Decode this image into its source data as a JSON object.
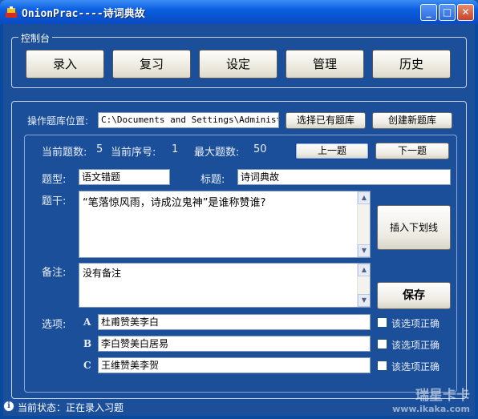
{
  "window": {
    "title": "OnionPrac----诗词典故",
    "minimize": "_",
    "maximize": "□",
    "close": "✕"
  },
  "console": {
    "legend": "控制台",
    "buttons": [
      "录入",
      "复习",
      "设定",
      "管理",
      "历史"
    ]
  },
  "db": {
    "label": "操作题库位置:",
    "path": "C:\\Documents and Settings\\Administrat",
    "select_btn": "选择已有题库",
    "create_btn": "创建新题库"
  },
  "counters": {
    "total_label": "当前题数:",
    "total_value": "5",
    "index_label": "当前序号:",
    "index_value": "1",
    "max_label": "最大题数:",
    "max_value": "50",
    "prev_btn": "上一题",
    "next_btn": "下一题"
  },
  "fields": {
    "type_label": "题型:",
    "type_value": "语文错题",
    "title_label": "标题:",
    "title_value": "诗词典故",
    "stem_label": "题干:",
    "stem_value": "“笔落惊风雨，诗成泣鬼神”是谁称赞谁?",
    "underline_btn": "插入下划线",
    "note_label": "备注:",
    "note_value": "没有备注",
    "save_btn": "保存"
  },
  "options": {
    "label": "选项:",
    "items": [
      {
        "key": "A",
        "value": "杜甫赞美李白",
        "correct_label": "该选项正确"
      },
      {
        "key": "B",
        "value": "李白赞美白居易",
        "correct_label": "该选项正确"
      },
      {
        "key": "C",
        "value": "王维赞美李贺",
        "correct_label": "该选项正确"
      }
    ]
  },
  "status": {
    "text": "当前状态：正在录入习题"
  },
  "watermark": {
    "cn": "瑞星卡卡",
    "url": "www.ikaka.com"
  }
}
